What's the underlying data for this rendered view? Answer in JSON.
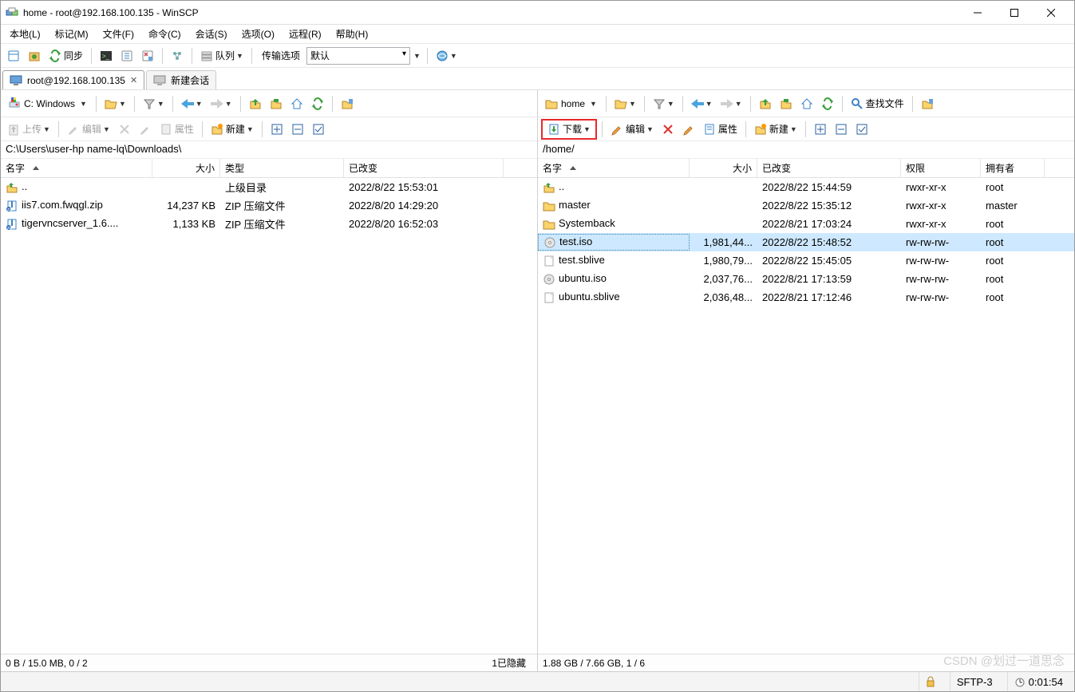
{
  "title": "home - root@192.168.100.135 - WinSCP",
  "menus": {
    "local": "本地(L)",
    "mark": "标记(M)",
    "files": "文件(F)",
    "cmd": "命令(C)",
    "session": "会话(S)",
    "options": "选项(O)",
    "remote": "远程(R)",
    "help": "帮助(H)"
  },
  "toolbar1": {
    "sync": "同步",
    "queue": "队列",
    "transfer_opts": "传输选项",
    "transfer_default": "默认"
  },
  "session_tab": "root@192.168.100.135",
  "new_session_tab": "新建会话",
  "nav": {
    "left_drive": "C: Windows",
    "right_drive": "home",
    "find_files": "查找文件"
  },
  "actions": {
    "upload": "上传",
    "edit": "编辑",
    "props": "属性",
    "new": "新建",
    "download": "下载"
  },
  "left": {
    "path": "C:\\Users\\user-hp name-lq\\Downloads\\",
    "cols": {
      "name": "名字",
      "size": "大小",
      "type": "类型",
      "changed": "已改变"
    },
    "name_w": 190,
    "size_w": 85,
    "type_w": 155,
    "changed_w": 200,
    "rows": [
      {
        "icon": "up",
        "name": "..",
        "size": "",
        "type": "上级目录",
        "changed": "2022/8/22  15:53:01"
      },
      {
        "icon": "zip",
        "name": "iis7.com.fwqgl.zip",
        "size": "14,237 KB",
        "type": "ZIP 压缩文件",
        "changed": "2022/8/20  14:29:20"
      },
      {
        "icon": "zip",
        "name": "tigervncserver_1.6....",
        "size": "1,133 KB",
        "type": "ZIP 压缩文件",
        "changed": "2022/8/20  16:52:03"
      }
    ],
    "status_left": "0 B / 15.0 MB,    0 / 2",
    "status_right": "1已隐藏"
  },
  "right": {
    "path": "/home/",
    "cols": {
      "name": "名字",
      "size": "大小",
      "changed": "已改变",
      "perm": "权限",
      "owner": "拥有者"
    },
    "name_w": 190,
    "size_w": 85,
    "changed_w": 180,
    "perm_w": 100,
    "owner_w": 80,
    "selected": "test.iso",
    "rows": [
      {
        "icon": "up",
        "name": "..",
        "size": "",
        "changed": "2022/8/22 15:44:59",
        "perm": "rwxr-xr-x",
        "owner": "root"
      },
      {
        "icon": "folder",
        "name": "master",
        "size": "",
        "changed": "2022/8/22 15:35:12",
        "perm": "rwxr-xr-x",
        "owner": "master"
      },
      {
        "icon": "folder",
        "name": "Systemback",
        "size": "",
        "changed": "2022/8/21 17:03:24",
        "perm": "rwxr-xr-x",
        "owner": "root"
      },
      {
        "icon": "iso",
        "name": "test.iso",
        "size": "1,981,44...",
        "changed": "2022/8/22 15:48:52",
        "perm": "rw-rw-rw-",
        "owner": "root"
      },
      {
        "icon": "file",
        "name": "test.sblive",
        "size": "1,980,79...",
        "changed": "2022/8/22 15:45:05",
        "perm": "rw-rw-rw-",
        "owner": "root"
      },
      {
        "icon": "iso",
        "name": "ubuntu.iso",
        "size": "2,037,76...",
        "changed": "2022/8/21 17:13:59",
        "perm": "rw-rw-rw-",
        "owner": "root"
      },
      {
        "icon": "file",
        "name": "ubuntu.sblive",
        "size": "2,036,48...",
        "changed": "2022/8/21 17:12:46",
        "perm": "rw-rw-rw-",
        "owner": "root"
      }
    ],
    "status_left": "1.88 GB / 7.66 GB,    1 / 6"
  },
  "footer": {
    "protocol": "SFTP-3",
    "time": "0:01:54"
  },
  "watermark": "CSDN @划过一道思念"
}
